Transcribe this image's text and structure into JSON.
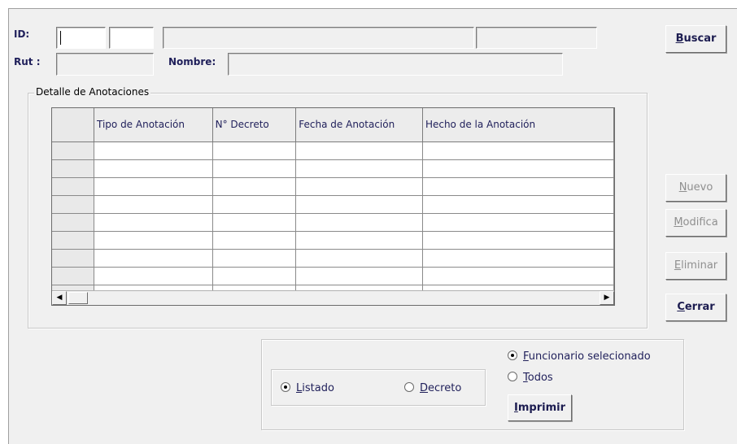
{
  "form": {
    "id_label": "ID:",
    "rut_label": "Rut :",
    "nombre_label": "Nombre:"
  },
  "buttons": {
    "buscar": {
      "first": "B",
      "rest": "uscar"
    },
    "nuevo": {
      "first": "N",
      "rest": "uevo"
    },
    "modifica": {
      "first": "M",
      "rest": "odifica"
    },
    "eliminar": {
      "first": "E",
      "rest": "liminar"
    },
    "cerrar": {
      "first": "C",
      "rest": "errar"
    },
    "imprimir": {
      "first": "I",
      "rest": "mprimir"
    }
  },
  "detalle": {
    "title": "Detalle de Anotaciones",
    "columns": [
      "Tipo de Anotación",
      "N° Decreto",
      "Fecha de Anotación",
      "Hecho de la  Anotación"
    ]
  },
  "print_options": {
    "listado": {
      "first": "L",
      "rest": "istado",
      "selected": true
    },
    "decreto": {
      "first": "D",
      "rest": "ecreto",
      "selected": false
    },
    "funcionario": {
      "first": "F",
      "rest": "uncionario selecionado",
      "selected": true
    },
    "todos": {
      "first": "T",
      "rest": "odos",
      "selected": false
    }
  }
}
